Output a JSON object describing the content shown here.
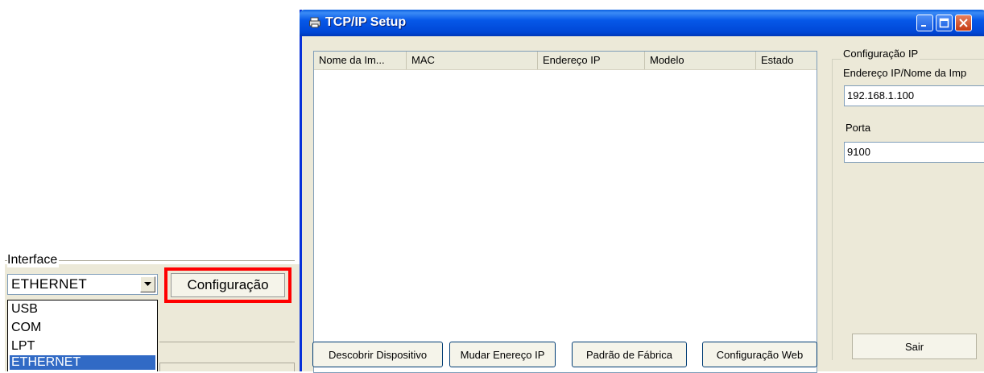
{
  "left_panel": {
    "interface_label": "Interface",
    "interface_select": {
      "value": "ETHERNET"
    },
    "config_button_label": "Configuração",
    "dropdown_options": [
      {
        "label": "USB",
        "selected": false
      },
      {
        "label": "COM",
        "selected": false
      },
      {
        "label": "LPT",
        "selected": false
      },
      {
        "label": "ETHERNET",
        "selected": true
      }
    ],
    "highlight_color": "#ff0000"
  },
  "window": {
    "title": "TCP/IP Setup",
    "titlebar_color": "#0658e8",
    "list": {
      "columns": [
        "Nome da Im...",
        "MAC",
        "Endereço IP",
        "Modelo",
        "Estado"
      ],
      "rows": []
    },
    "buttons": {
      "discover": "Descobrir Dispositivo",
      "change_ip": "Mudar Enereço IP",
      "factory_default": "Padrão de Fábrica",
      "web_config": "Configuração Web"
    },
    "config": {
      "group_title": "Configuração IP",
      "ip_label": "Endereço IP/Nome da Imp",
      "ip_value": "192.168.1.100",
      "port_label": "Porta",
      "port_value": "9100",
      "exit_label": "Sair"
    }
  }
}
